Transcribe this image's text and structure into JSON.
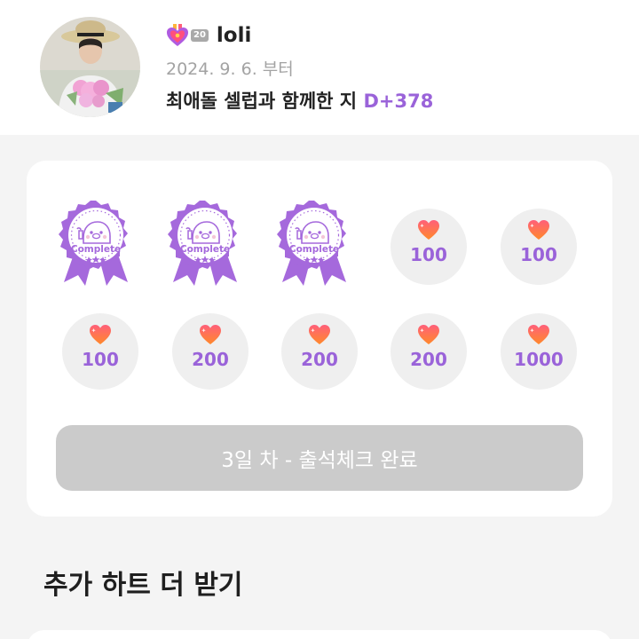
{
  "profile": {
    "avatar_icon": "user-avatar-photo",
    "level_icon": "heart-medal-icon",
    "level": "20",
    "username": "loli",
    "since_date": "2024. 9. 6. 부터",
    "together_text": "최애돌 셀럽과 함께한 지",
    "dday": "D+378"
  },
  "attendance": {
    "completed_days": 3,
    "stamps": [
      {
        "label": "Complete",
        "icon": "complete-stamp-icon"
      },
      {
        "label": "Complete",
        "icon": "complete-stamp-icon"
      },
      {
        "label": "Complete",
        "icon": "complete-stamp-icon"
      }
    ],
    "rewards": [
      {
        "amount": "100",
        "icon": "heart-icon"
      },
      {
        "amount": "100",
        "icon": "heart-icon"
      },
      {
        "amount": "100",
        "icon": "heart-icon"
      },
      {
        "amount": "200",
        "icon": "heart-icon"
      },
      {
        "amount": "200",
        "icon": "heart-icon"
      },
      {
        "amount": "200",
        "icon": "heart-icon"
      },
      {
        "amount": "1000",
        "icon": "heart-icon"
      }
    ],
    "status_label": "3일 차 - 출석체크 완료"
  },
  "extra_section": {
    "title": "추가 하트 더 받기"
  },
  "colors": {
    "accent_purple": "#9a63d9",
    "stamp_purple": "#a569dc",
    "heart_gradient_top": "#ff5f7a",
    "heart_gradient_bottom": "#ff8a2a",
    "reward_bg": "#efefef",
    "disabled_button": "#cbcbcb"
  }
}
